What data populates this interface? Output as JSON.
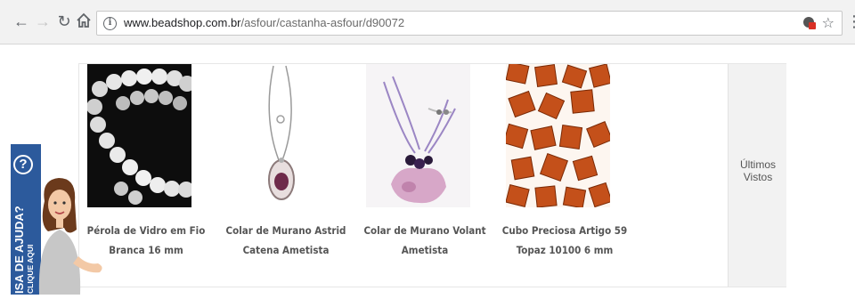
{
  "browser": {
    "url_domain": "www.beadshop.com.br",
    "url_path": "/asfour/castanha-asfour/d90072",
    "icons": {
      "back": "back-arrow-icon",
      "forward": "forward-arrow-icon",
      "reload": "reload-icon",
      "home": "home-icon",
      "info": "info-icon",
      "extension": "extension-icon",
      "bookmark": "star-icon",
      "menu": "menu-icon"
    }
  },
  "products": [
    {
      "name": "Pérola de Vidro em Fio Branca 16 mm"
    },
    {
      "name": "Colar de Murano Astrid Catena Ametista"
    },
    {
      "name": "Colar de Murano Volant Ametista"
    },
    {
      "name": "Cubo Preciosa Artigo 59 Topaz 10100 6 mm"
    }
  ],
  "recent": {
    "label": "Últimos Vistos"
  },
  "help": {
    "line1": "ISA DE AJUDA?",
    "line2": "CLIQUE AQUI",
    "question": "?"
  },
  "colors": {
    "help_tab": "#2c5a9c",
    "product_text": "#555555"
  }
}
